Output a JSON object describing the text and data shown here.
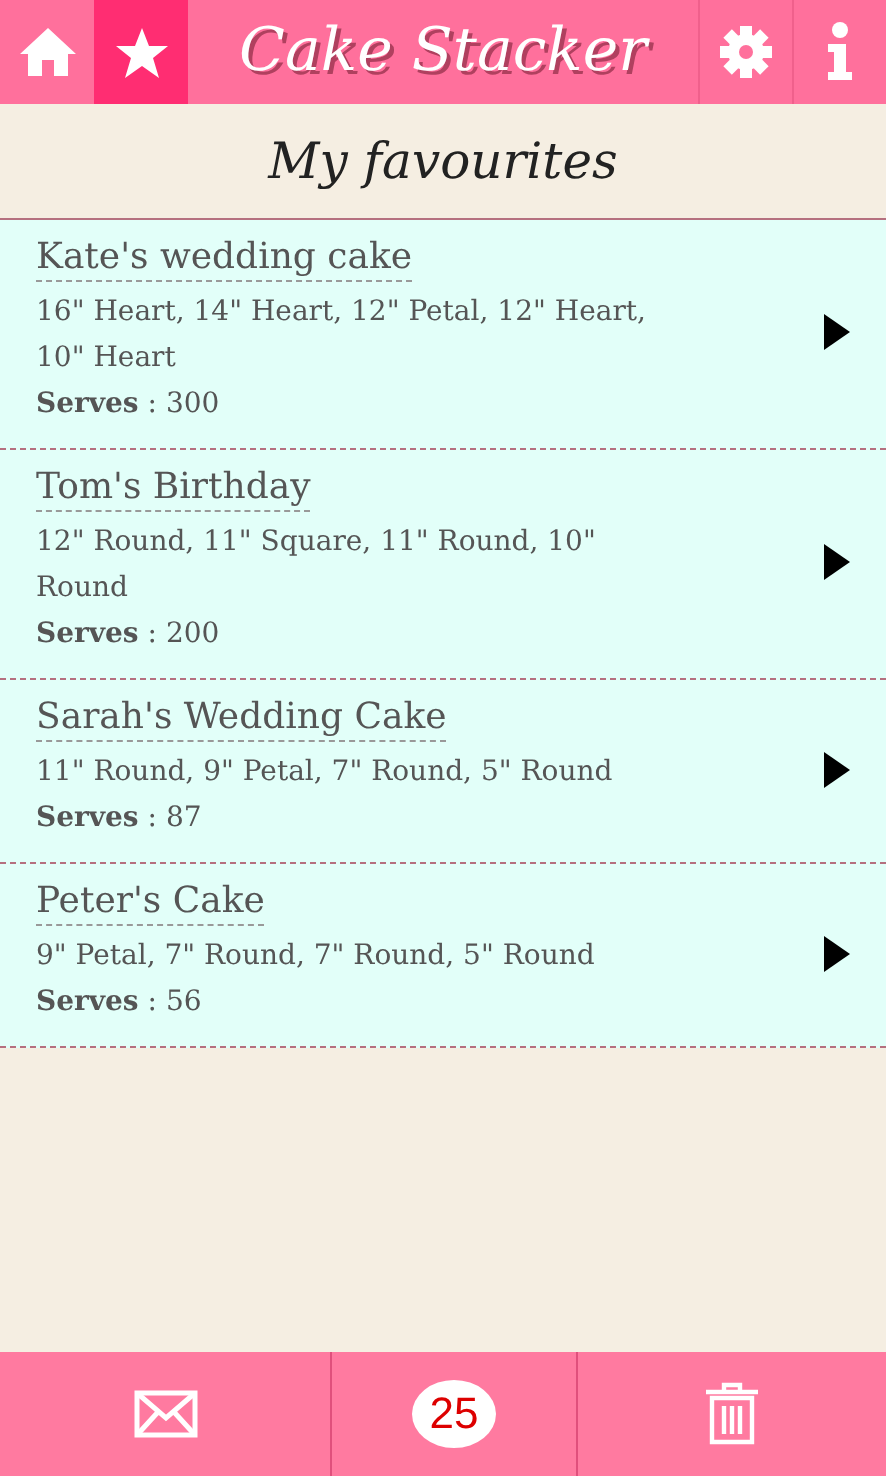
{
  "header": {
    "title": "Cake Stacker",
    "nav": [
      {
        "kind": "home",
        "selected": false
      },
      {
        "kind": "star",
        "selected": true
      }
    ],
    "actions": [
      {
        "kind": "settings"
      },
      {
        "kind": "info"
      }
    ]
  },
  "page_title": "My favourites",
  "cakes": [
    {
      "name": "Kate's wedding cake",
      "tiers": "16\" Heart, 14\" Heart, 12\" Petal, 12\" Heart, 10\" Heart",
      "serves": "**Serves** : 300"
    },
    {
      "name": "Tom's Birthday",
      "tiers": "12\" Round, 11\" Square, 11\" Round, 10\" Round",
      "serves": "**Serves** : 200"
    },
    {
      "name": "Sarah's Wedding Cake",
      "tiers": "11\" Round, 9\" Petal, 7\" Round, 5\" Round",
      "serves": "**Serves** : 87"
    },
    {
      "name": "Peter's Cake",
      "tiers": "9\" Petal, 7\" Round, 7\" Round, 5\" Round",
      "serves": "**Serves** : 56"
    }
  ],
  "footer": [
    {
      "kind": "mail"
    },
    {
      "kind": "count",
      "label": "25"
    },
    {
      "kind": "trash"
    }
  ]
}
